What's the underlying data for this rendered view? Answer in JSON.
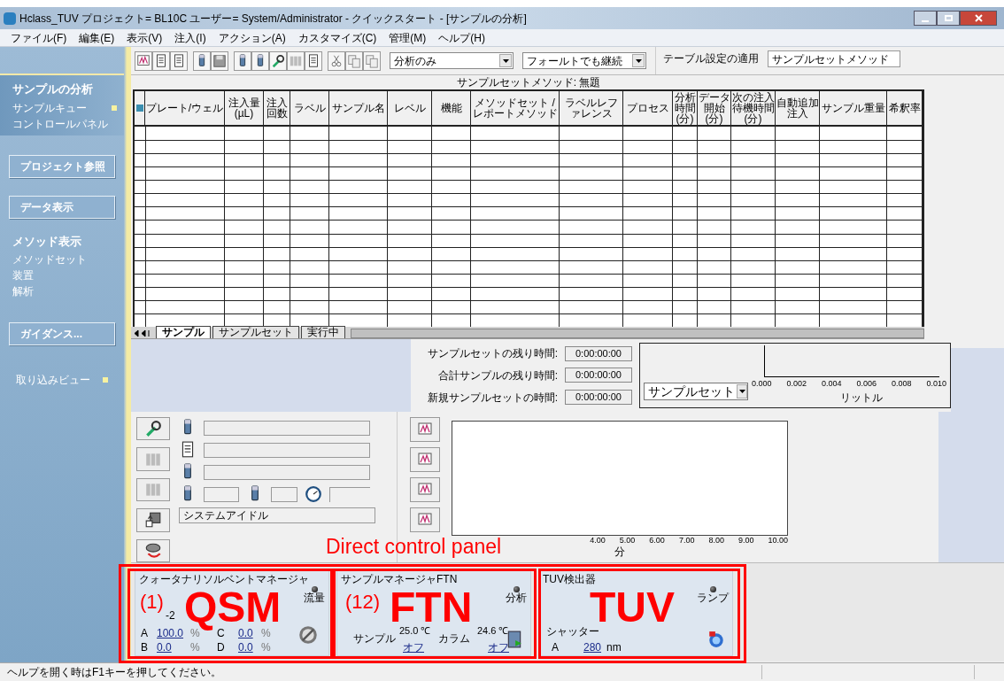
{
  "window": {
    "title": "Hclass_TUV プロジェクト= BL10C ユーザー= System/Administrator - クイックスタート - [サンプルの分析]"
  },
  "menu": [
    "ファイル(F)",
    "編集(E)",
    "表示(V)",
    "注入(I)",
    "アクション(A)",
    "カスタマイズ(C)",
    "管理(M)",
    "ヘルプ(H)"
  ],
  "sidebar": [
    {
      "kind": "group",
      "label": "サンプルの分析",
      "selected": true,
      "items": [
        {
          "label": "サンプルキュー",
          "marker": true
        },
        {
          "label": "コントロールパネル",
          "marker": false
        }
      ]
    },
    {
      "kind": "button",
      "label": "プロジェクト参照",
      "selected": false
    },
    {
      "kind": "button",
      "label": "データ表示",
      "selected": false
    },
    {
      "kind": "group",
      "label": "メソッド表示",
      "selected": false,
      "items": [
        {
          "label": "メソッドセット",
          "marker": false
        },
        {
          "label": "装置",
          "marker": false
        },
        {
          "label": "解析",
          "marker": false
        }
      ]
    },
    {
      "kind": "button",
      "label": "ガイダンス...",
      "selected": false
    },
    {
      "kind": "link",
      "label": "取り込みビュー",
      "marker": true
    }
  ],
  "toolbar": {
    "dropdowns": [
      "分析のみ",
      "フォールトでも継続"
    ],
    "table_setting_label": "テーブル設定の適用",
    "table_setting_value": "サンプルセットメソッド"
  },
  "table": {
    "title": "サンプルセットメソッド: 無題",
    "columns": [
      "プレート/ウェル",
      "注入量(µL)",
      "注入回数",
      "ラベル",
      "サンプル名",
      "レベル",
      "機能",
      "メソッドセット / レポートメソッド",
      "ラベルレファレンス",
      "プロセス",
      "分析時間(分)",
      "データ開始(分)",
      "次の注入待機時間(分)",
      "自動追加注入",
      "サンプル重量",
      "希釈率"
    ]
  },
  "tabs": [
    {
      "label": "サンプル",
      "selected": true
    },
    {
      "label": "サンプルセット",
      "selected": false
    },
    {
      "label": "実行中",
      "selected": false
    }
  ],
  "times": [
    {
      "label": "サンプルセットの残り時間:",
      "value": "0:00:00:00"
    },
    {
      "label": "合計サンプルの残り時間:",
      "value": "0:00:00:00"
    },
    {
      "label": "新規サンプルセットの時間:",
      "value": "0:00:00:00"
    }
  ],
  "volume_chart": {
    "selector": "サンプルセット",
    "xticks": [
      "0.000",
      "0.002",
      "0.004",
      "0.006",
      "0.008",
      "0.010"
    ],
    "xlabel": "リットル"
  },
  "status_panel": {
    "message": "システムアイドル"
  },
  "run_chart": {
    "xticks": [
      "4.00",
      "5.00",
      "6.00",
      "7.00",
      "8.00",
      "9.00",
      "10.00"
    ],
    "xlabel": "分"
  },
  "modules": [
    {
      "kind": "qsm",
      "title": "クォータナリソルベントマネージャ",
      "indicator": "流量",
      "pressure": "-2",
      "rows": [
        [
          "A",
          "100.0",
          "%",
          "C",
          "0.0",
          "%"
        ],
        [
          "B",
          "0.0",
          "%",
          "D",
          "0.0",
          "%"
        ]
      ]
    },
    {
      "kind": "ftn",
      "title": "サンプルマネージャFTN",
      "indicator": "分析",
      "zones": [
        {
          "label": "サンプル",
          "temp": "25.0 ℃",
          "state": "オフ"
        },
        {
          "label": "カラム",
          "temp": "24.6 ℃",
          "state": "オフ"
        }
      ]
    },
    {
      "kind": "tuv",
      "title": "TUV検出器",
      "indicator": "ランプ",
      "shutter_label": "シャッター",
      "channel": "A",
      "wavelength": "280",
      "unit": "nm"
    }
  ],
  "annotations": {
    "panel_label": "Direct control panel",
    "boxes": [
      {
        "number": "(1)",
        "name": "QSM"
      },
      {
        "number": "(12)",
        "name": "FTN"
      },
      {
        "name": "TUV"
      }
    ]
  },
  "status_bar": "ヘルプを開く時はF1キーを押してください。"
}
